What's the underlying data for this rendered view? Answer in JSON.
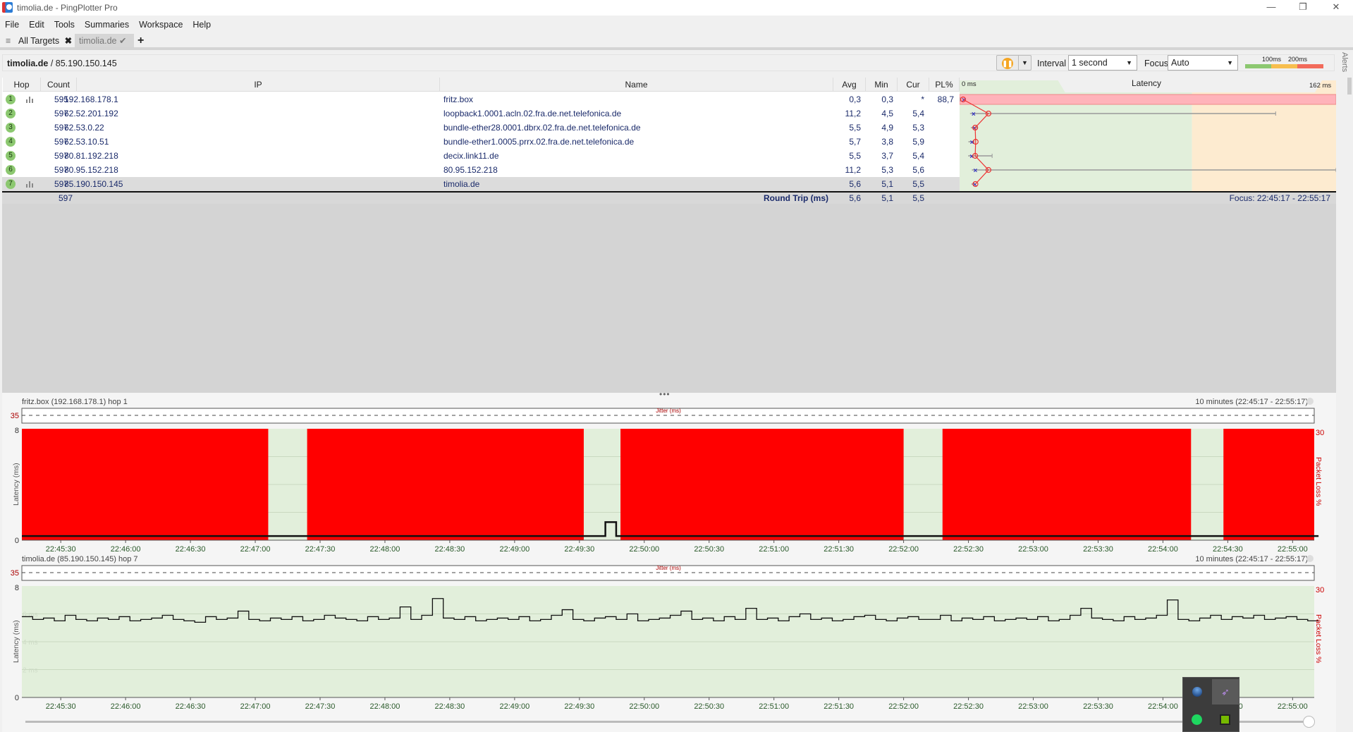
{
  "window": {
    "title": "timolia.de - PingPlotter Pro",
    "minimize": "—",
    "restore": "❐",
    "close": "✕"
  },
  "menu": [
    "File",
    "Edit",
    "Tools",
    "Summaries",
    "Workspace",
    "Help"
  ],
  "tabs": {
    "all_targets": "All Targets",
    "active": "timolia.de",
    "add": "+"
  },
  "target": {
    "host": "timolia.de",
    "ip": " / 85.190.150.145"
  },
  "toolbar": {
    "interval_label": "Interval",
    "interval_value": "1 second",
    "focus_label": "Focus",
    "focus_value": "Auto",
    "legend_100": "100ms",
    "legend_200": "200ms",
    "colors": {
      "good": "#8cc870",
      "warn": "#f7be4e",
      "bad": "#f26b5b",
      "pause": "#f5a623"
    }
  },
  "alerts_label": "Alerts",
  "columns": {
    "hop": "Hop",
    "count": "Count",
    "ip": "IP",
    "name": "Name",
    "avg": "Avg",
    "min": "Min",
    "cur": "Cur",
    "pl": "PL%",
    "latency": "Latency",
    "lat_min": "0 ms",
    "lat_max": "162 ms"
  },
  "hops": [
    {
      "hop": "1",
      "count": "595",
      "ip": "192.168.178.1",
      "name": "fritz.box",
      "avg": "0,3",
      "min": "0,3",
      "cur": "*",
      "pl": "88,7",
      "graph": true,
      "avg_ms": 0.3,
      "min_ms": 0.3,
      "max_ms": 0.3
    },
    {
      "hop": "2",
      "count": "597",
      "ip": "62.52.201.192",
      "name": "loopback1.0001.acln.02.fra.de.net.telefonica.de",
      "avg": "11,2",
      "min": "4,5",
      "cur": "5,4",
      "pl": "",
      "avg_ms": 11.2,
      "min_ms": 4.5,
      "max_ms": 136
    },
    {
      "hop": "3",
      "count": "597",
      "ip": "62.53.0.22",
      "name": "bundle-ether28.0001.dbrx.02.fra.de.net.telefonica.de",
      "avg": "5,5",
      "min": "4,9",
      "cur": "5,3",
      "pl": "",
      "avg_ms": 5.5,
      "min_ms": 4.9,
      "max_ms": 7.5
    },
    {
      "hop": "4",
      "count": "597",
      "ip": "62.53.10.51",
      "name": "bundle-ether1.0005.prrx.02.fra.de.net.telefonica.de",
      "avg": "5,7",
      "min": "3,8",
      "cur": "5,9",
      "pl": "",
      "avg_ms": 5.7,
      "min_ms": 3.8,
      "max_ms": 6.2
    },
    {
      "hop": "5",
      "count": "597",
      "ip": "80.81.192.218",
      "name": "decix.link11.de",
      "avg": "5,5",
      "min": "3,7",
      "cur": "5,4",
      "pl": "",
      "avg_ms": 5.5,
      "min_ms": 3.7,
      "max_ms": 14
    },
    {
      "hop": "6",
      "count": "597",
      "ip": "80.95.152.218",
      "name": "80.95.152.218",
      "avg": "11,2",
      "min": "5,3",
      "cur": "5,6",
      "pl": "",
      "avg_ms": 11.2,
      "min_ms": 5.3,
      "max_ms": 162
    },
    {
      "hop": "7",
      "count": "597",
      "ip": "85.190.150.145",
      "name": "timolia.de",
      "avg": "5,6",
      "min": "5,1",
      "cur": "5,5",
      "pl": "",
      "graph": true,
      "selected": true,
      "avg_ms": 5.6,
      "min_ms": 5.1,
      "max_ms": 6.0
    }
  ],
  "summary": {
    "count": "597",
    "label": "Round Trip (ms)",
    "avg": "5,6",
    "min": "5,1",
    "cur": "5,5",
    "focus": "Focus: 22:45:17 - 22:55:17"
  },
  "charts": [
    {
      "title": "fritz.box (192.168.178.1) hop 1",
      "range": "10 minutes (22:45:17 - 22:55:17)",
      "jitter_label": "Jitter (ms)",
      "jitter_max": "35",
      "ylabel": "Latency (ms)",
      "y2label": "Packet Loss %",
      "y_top": "8",
      "y_zero": "0",
      "y2_top": "30",
      "grid_labels": [
        "6 ms",
        "4 ms",
        "2 ms"
      ],
      "loss_intervals": [
        [
          "22:45:12",
          "22:47:06"
        ],
        [
          "22:47:24",
          "22:49:32"
        ],
        [
          "22:49:49",
          "22:52:00"
        ],
        [
          "22:52:18",
          "22:54:13"
        ],
        [
          "22:54:28",
          "22:55:10"
        ]
      ],
      "latency": {
        "start": "22:45:12",
        "step_s": 5,
        "values": [
          0.3,
          0.3,
          0.3,
          0.3,
          0.3,
          0.3,
          0.3,
          0.3,
          0.3,
          0.3,
          0.3,
          0.3,
          0.3,
          0.3,
          0.3,
          0.3,
          0.3,
          0.3,
          0.3,
          0.3,
          0.3,
          0.3,
          0.3,
          0.3,
          0.3,
          0.3,
          0.3,
          0.3,
          0.3,
          0.3,
          0.3,
          0.3,
          0.3,
          0.3,
          0.3,
          0.3,
          0.3,
          0.3,
          0.3,
          0.3,
          0.3,
          0.3,
          0.3,
          0.3,
          0.3,
          0.3,
          0.3,
          0.3,
          0.3,
          0.3,
          0.3,
          0.3,
          0.3,
          0.3,
          1.3,
          0.3,
          0.3,
          0.3,
          0.3,
          0.3,
          0.3,
          0.3,
          0.3,
          0.3,
          0.3,
          0.3,
          0.3,
          0.3,
          0.3,
          0.3,
          0.3,
          0.3,
          0.3,
          0.3,
          0.3,
          0.3,
          0.3,
          0.3,
          0.3,
          0.3,
          0.3,
          0.3,
          0.3,
          0.3,
          0.3,
          0.3,
          0.3,
          0.3,
          0.3,
          0.3,
          0.3,
          0.3,
          0.3,
          0.3,
          0.3,
          0.3,
          0.3,
          0.3,
          0.3,
          0.3,
          0.3,
          0.3,
          0.3,
          0.3,
          0.3,
          0.3,
          0.3,
          0.3,
          0.3,
          0.3,
          0.3,
          0.3,
          0.3,
          0.3,
          0.3,
          0.3,
          0.3,
          0.3,
          0.3,
          0.3
        ]
      }
    },
    {
      "title": "timolia.de (85.190.150.145) hop 7",
      "range": "10 minutes (22:45:17 - 22:55:17)",
      "jitter_label": "Jitter (ms)",
      "jitter_max": "35",
      "ylabel": "Latency (ms)",
      "y2label": "Packet Loss %",
      "y_top": "8",
      "y_zero": "0",
      "y2_top": "30",
      "grid_labels": [
        "6 ms",
        "4 ms",
        "2 ms"
      ],
      "loss_intervals": [],
      "latency": {
        "start": "22:45:12",
        "step_s": 5,
        "values": [
          5.8,
          5.6,
          5.7,
          5.5,
          5.9,
          5.6,
          5.5,
          5.7,
          5.6,
          5.8,
          5.5,
          5.6,
          5.7,
          5.9,
          5.6,
          5.5,
          5.4,
          5.8,
          5.6,
          5.7,
          6.2,
          5.6,
          5.5,
          5.7,
          5.6,
          5.8,
          5.5,
          5.6,
          5.9,
          5.7,
          5.6,
          5.5,
          5.8,
          5.6,
          5.7,
          6.5,
          5.6,
          5.9,
          7.1,
          5.7,
          5.6,
          5.8,
          5.5,
          5.6,
          5.7,
          5.6,
          5.8,
          5.5,
          5.6,
          5.9,
          6.3,
          5.6,
          5.5,
          5.7,
          5.8,
          5.6,
          6.0,
          5.5,
          5.6,
          5.7,
          5.9,
          6.2,
          5.6,
          5.7,
          5.5,
          5.8,
          5.6,
          6.4,
          5.6,
          5.7,
          5.5,
          5.8,
          6.0,
          5.6,
          5.7,
          5.5,
          5.6,
          5.8,
          5.9,
          5.6,
          5.5,
          5.7,
          5.8,
          5.6,
          5.6,
          5.9,
          5.5,
          5.7,
          5.6,
          5.8,
          5.5,
          5.6,
          5.7,
          5.6,
          5.8,
          5.5,
          5.6,
          5.9,
          6.4,
          5.7,
          5.6,
          5.5,
          5.8,
          5.6,
          5.7,
          5.9,
          7.0,
          5.6,
          5.5,
          5.7,
          5.9,
          5.6,
          5.8,
          5.7,
          5.9,
          5.6,
          5.7,
          5.8,
          5.6,
          5.5
        ]
      }
    }
  ],
  "axis": {
    "start": "22:45:12",
    "end": "22:55:10",
    "ticks": [
      "22:45:30",
      "22:46:00",
      "22:46:30",
      "22:47:00",
      "22:47:30",
      "22:48:00",
      "22:48:30",
      "22:49:00",
      "22:49:30",
      "22:50:00",
      "22:50:30",
      "22:51:00",
      "22:51:30",
      "22:52:00",
      "22:52:30",
      "22:53:00",
      "22:53:30",
      "22:54:00",
      "22:54:30",
      "22:55:00"
    ]
  }
}
